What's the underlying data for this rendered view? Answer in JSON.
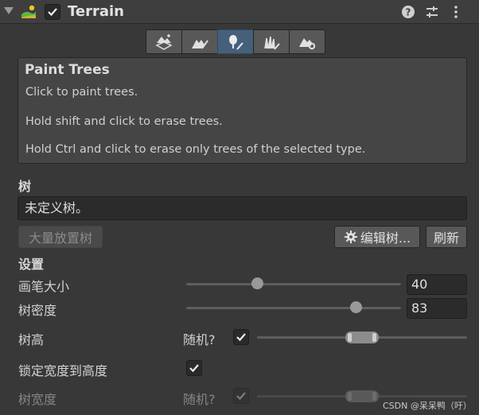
{
  "header": {
    "title": "Terrain",
    "enabled": true,
    "icons": [
      "foldout-arrow-icon",
      "terrain-component-icon",
      "help-icon",
      "preset-sliders-icon",
      "kebab-menu-icon"
    ]
  },
  "toolbar": {
    "tools": [
      {
        "id": "create-neighbor",
        "icon": "create-neighbor-terrains-icon"
      },
      {
        "id": "paint-terrain",
        "icon": "paint-terrain-icon"
      },
      {
        "id": "paint-trees",
        "icon": "paint-trees-icon",
        "active": true
      },
      {
        "id": "paint-details",
        "icon": "paint-details-icon"
      },
      {
        "id": "terrain-settings",
        "icon": "terrain-settings-icon"
      }
    ]
  },
  "help": {
    "title": "Paint Trees",
    "lines": [
      "Click to paint trees.",
      "Hold shift and click to erase trees.",
      "Hold Ctrl and click to erase only trees of the selected type."
    ]
  },
  "trees": {
    "label": "树",
    "list_text": "未定义树。",
    "mass_place_label": "大量放置树",
    "edit_label": "编辑树...",
    "refresh_label": "刷新"
  },
  "settings": {
    "label": "设置",
    "brush_size": {
      "label": "画笔大小",
      "value": "40",
      "fraction": 0.33
    },
    "tree_density": {
      "label": "树密度",
      "value": "83",
      "fraction": 0.79
    },
    "tree_height": {
      "label": "树高",
      "random_label": "随机?",
      "random": true,
      "range_min": 0.42,
      "range_max": 0.58
    },
    "lock_width": {
      "label": "锁定宽度到高度",
      "checked": true
    },
    "tree_width": {
      "label": "树宽度",
      "random_label": "随机?",
      "random": true,
      "range_min": 0.42,
      "range_max": 0.58
    }
  },
  "watermark": "CSDN @呆呆鸭（吁）",
  "colors": {
    "background": "#383838",
    "active_tool": "#46607c",
    "field": "#2b2b2b"
  }
}
